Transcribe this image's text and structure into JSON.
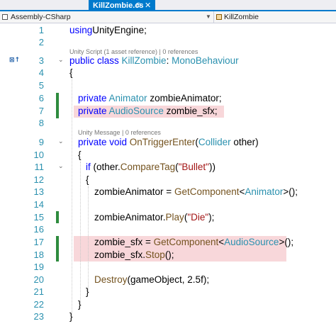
{
  "tab": {
    "title": "KillZombie.cs",
    "pin": "⊕",
    "close": "✕"
  },
  "navbar": {
    "project": "Assembly-CSharp",
    "class_name": "KillZombie"
  },
  "hints": {
    "class_hint": "Unity Script (1 asset reference) | 0 references",
    "method_hint": "Unity Message | 0 references"
  },
  "margin_icon": "⊠↑",
  "line_numbers": [
    "1",
    "2",
    "3",
    "4",
    "5",
    "6",
    "7",
    "8",
    "9",
    "10",
    "11",
    "12",
    "13",
    "14",
    "15",
    "16",
    "17",
    "18",
    "19",
    "20",
    "21",
    "22",
    "23"
  ],
  "code": {
    "l1": [
      [
        "kw",
        "using"
      ],
      [
        "",
        "UnityEngine;"
      ]
    ],
    "l3": [
      [
        "kw",
        "public class "
      ],
      [
        "ty",
        "KillZombie"
      ],
      [
        "",
        ": "
      ],
      [
        "ty",
        "MonoBehaviour"
      ]
    ],
    "l4": [
      [
        "",
        "{"
      ]
    ],
    "l6": [
      [
        "kw",
        "private "
      ],
      [
        "ty",
        "Animator"
      ],
      [
        "",
        " zombieAnimator;"
      ]
    ],
    "l7": [
      [
        "kw",
        "private "
      ],
      [
        "ty",
        "AudioSource"
      ],
      [
        "",
        " zombie_sfx;"
      ]
    ],
    "l9": [
      [
        "kw",
        "private void "
      ],
      [
        "meth",
        "OnTriggerEnter"
      ],
      [
        "",
        "("
      ],
      [
        "ty",
        "Collider"
      ],
      [
        "",
        " other)"
      ]
    ],
    "l10": [
      [
        "",
        "{"
      ]
    ],
    "l11": [
      [
        "kw",
        "if "
      ],
      [
        "",
        "(other."
      ],
      [
        "meth",
        "CompareTag"
      ],
      [
        "",
        "("
      ],
      [
        "st",
        "\"Bullet\""
      ],
      [
        "",
        "))"
      ]
    ],
    "l12": [
      [
        "",
        "{"
      ]
    ],
    "l13": [
      [
        "",
        "zombieAnimator = "
      ],
      [
        "meth",
        "GetComponent"
      ],
      [
        "",
        "<"
      ],
      [
        "ty",
        "Animator"
      ],
      [
        "",
        ">();"
      ]
    ],
    "l15": [
      [
        "",
        "zombieAnimator."
      ],
      [
        "meth",
        "Play"
      ],
      [
        "",
        "("
      ],
      [
        "st",
        "\"Die\""
      ],
      [
        "",
        ");"
      ]
    ],
    "l17": [
      [
        "",
        "zombie_sfx = "
      ],
      [
        "meth",
        "GetComponent"
      ],
      [
        "",
        "<"
      ],
      [
        "ty",
        "AudioSource"
      ],
      [
        "",
        ">();"
      ]
    ],
    "l18": [
      [
        "",
        "zombie_sfx."
      ],
      [
        "meth",
        "Stop"
      ],
      [
        "",
        "();"
      ]
    ],
    "l20": [
      [
        "meth",
        "Destroy"
      ],
      [
        "",
        "(gameObject, 2.5f);"
      ]
    ],
    "l21": [
      [
        "",
        "}"
      ]
    ],
    "l22": [
      [
        "",
        "}"
      ]
    ],
    "l23": [
      [
        "",
        "}"
      ]
    ]
  }
}
